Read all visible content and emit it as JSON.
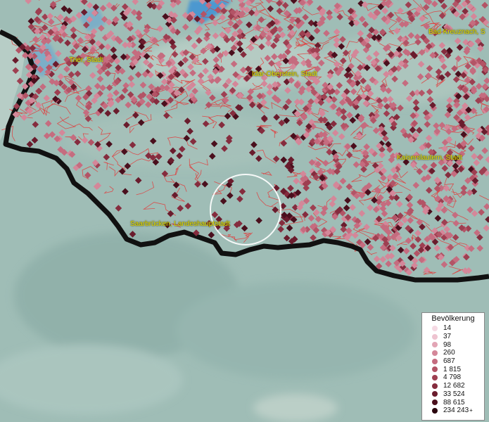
{
  "map": {
    "places": [
      {
        "name": "Trier, Stadt"
      },
      {
        "name": "Idar-Oberstein, Stadt"
      },
      {
        "name": "Bad Kreuznach, S"
      },
      {
        "name": "Kaiserslautern, Stadt"
      },
      {
        "name": "Saarbrücken, Landeshauptstadt"
      }
    ],
    "colors": {
      "terrain": "#9fbdb6",
      "terrain_dark": "#86a8a2",
      "boundary_lines": "#e33a3a",
      "border": "#111111",
      "water": "#3a8fd6",
      "label": "#e8e000",
      "highlight_circle": "#ffffff"
    }
  },
  "legend": {
    "title": "Bevölkerung",
    "items": [
      {
        "label": "14",
        "color": "#f5d9e3"
      },
      {
        "label": "37",
        "color": "#eec3d0"
      },
      {
        "label": "98",
        "color": "#e2a5b5"
      },
      {
        "label": "260",
        "color": "#d48799"
      },
      {
        "label": "687",
        "color": "#c56c7f"
      },
      {
        "label": "1 815",
        "color": "#b35466"
      },
      {
        "label": "4 798",
        "color": "#9e3f51"
      },
      {
        "label": "12 682",
        "color": "#852c3e"
      },
      {
        "label": "33 524",
        "color": "#6a1c2d"
      },
      {
        "label": "88 615",
        "color": "#4a0f1d"
      },
      {
        "label": "234 243",
        "color": "#2a050e"
      }
    ],
    "plus_marker": "+"
  }
}
